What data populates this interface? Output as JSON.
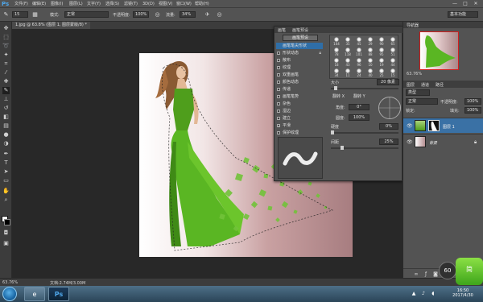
{
  "app": {
    "logo": "Ps",
    "menu": [
      "文件(F)",
      "编辑(E)",
      "图像(I)",
      "图层(L)",
      "文字(Y)",
      "选择(S)",
      "滤镜(T)",
      "3D(D)",
      "视图(V)",
      "窗口(W)",
      "帮助(H)"
    ],
    "window_controls": [
      "—",
      "□",
      "✕"
    ]
  },
  "options": {
    "brush_size": "15",
    "mode_label": "模式:",
    "mode_value": "正常",
    "opacity_label": "不透明度:",
    "opacity_value": "100%",
    "flow_label": "流量:",
    "flow_value": "34%",
    "workspace": "基本功能"
  },
  "document": {
    "tab_title": "1.jpg @ 63.8% (图层 1, 图层蒙版/8) *"
  },
  "brush_panel": {
    "tabs": [
      "画笔",
      "画笔预设"
    ],
    "preset_button": "画笔预设",
    "options": [
      {
        "label": "画笔笔尖形状",
        "checked": false,
        "selected": true
      },
      {
        "label": "形状动态",
        "checked": false
      },
      {
        "label": "散布",
        "checked": false
      },
      {
        "label": "纹理",
        "checked": false
      },
      {
        "label": "双重画笔",
        "checked": false
      },
      {
        "label": "颜色动态",
        "checked": false
      },
      {
        "label": "传递",
        "checked": false
      },
      {
        "label": "画笔笔势",
        "checked": false
      },
      {
        "label": "杂色",
        "checked": false
      },
      {
        "label": "湿边",
        "checked": false
      },
      {
        "label": "建立",
        "checked": false
      },
      {
        "label": "平滑",
        "checked": true
      },
      {
        "label": "保护纹理",
        "checked": false
      }
    ],
    "tip_sizes": [
      "104",
      "35",
      "45",
      "29",
      "90",
      "65",
      "78",
      "118",
      "101",
      "88",
      "95",
      "51",
      "18",
      "43",
      "96",
      "10",
      "19",
      "44",
      "34",
      "11",
      "24",
      "40",
      "25",
      "15"
    ],
    "size_label": "大小",
    "size_value": "20 像素",
    "flip_x": "翻转 X",
    "flip_y": "翻转 Y",
    "angle_label": "角度:",
    "angle_value": "0°",
    "roundness_label": "圆度:",
    "roundness_value": "100%",
    "hardness_label": "硬度",
    "hardness_value": "0%",
    "spacing_label": "间距",
    "spacing_value": "25%"
  },
  "navigator": {
    "tabs": [
      "导航器"
    ],
    "zoom": "63.76%"
  },
  "layers_panel": {
    "tabs": [
      "图层",
      "通道",
      "路径"
    ],
    "kind_label": "类型",
    "blend_mode": "正常",
    "opacity_label": "不透明度:",
    "opacity_value": "100%",
    "lock_label": "锁定:",
    "fill_label": "填充:",
    "fill_value": "100%",
    "layers": [
      {
        "name": "图层 1",
        "selected": true
      },
      {
        "name": "背景",
        "selected": false
      }
    ]
  },
  "status": {
    "zoom": "63.76%",
    "doc_info": "文档:2.74M/3.00M"
  },
  "overlay": {
    "zoom_badge": "60",
    "logo_text": "简"
  },
  "taskbar": {
    "time": "16:50",
    "date": "2017/4/30"
  },
  "colors": {
    "accent_selection": "#2f6ea7",
    "ps_blue": "#4ea6ea",
    "navigator_frame": "#d01e1e"
  }
}
